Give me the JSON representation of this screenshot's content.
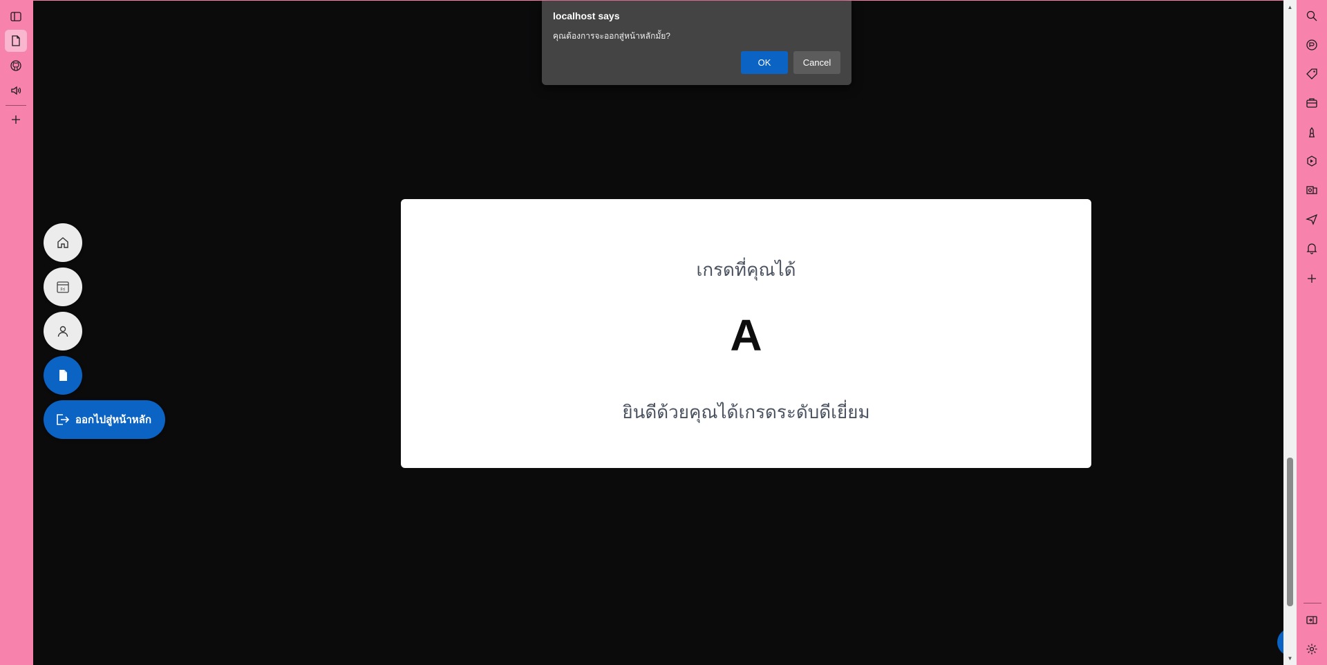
{
  "colors": {
    "sidebar_bg": "#f783ad",
    "page_bg": "#0b0b0c",
    "accent_blue": "#0b63c4",
    "dialog_bg": "#444444"
  },
  "left_sidebar": {
    "items": [
      {
        "icon": "sidebar-toggle-icon"
      },
      {
        "icon": "document-icon",
        "active": true
      },
      {
        "icon": "github-icon"
      },
      {
        "icon": "speaker-icon"
      },
      {
        "icon": "plus-icon"
      }
    ]
  },
  "right_sidebar": {
    "items": [
      {
        "icon": "search-icon"
      },
      {
        "icon": "copilot-icon"
      },
      {
        "icon": "tag-icon"
      },
      {
        "icon": "briefcase-icon"
      },
      {
        "icon": "chess-icon"
      },
      {
        "icon": "games-icon"
      },
      {
        "icon": "outlook-icon"
      },
      {
        "icon": "send-icon"
      },
      {
        "icon": "bell-icon"
      },
      {
        "icon": "plus-icon"
      },
      {
        "icon": "split-screen-icon"
      },
      {
        "icon": "settings-icon"
      }
    ]
  },
  "grade_card": {
    "title": "เกรดที่คุณได้",
    "grade": "A",
    "message": "ยินดีด้วยคุณได้เกรดระดับดีเยี่ยม"
  },
  "floating_nav": {
    "items": [
      {
        "icon": "home-icon"
      },
      {
        "icon": "calendar-icon",
        "text": "Fri"
      },
      {
        "icon": "person-icon"
      },
      {
        "icon": "document-icon",
        "active": true
      }
    ],
    "exit_label": "ออกไปสู่หน้าหลัก"
  },
  "dialog": {
    "title": "localhost says",
    "message": "คุณต้องการจะออกสู่หน้าหลักมั้ย?",
    "ok_label": "OK",
    "cancel_label": "Cancel"
  }
}
